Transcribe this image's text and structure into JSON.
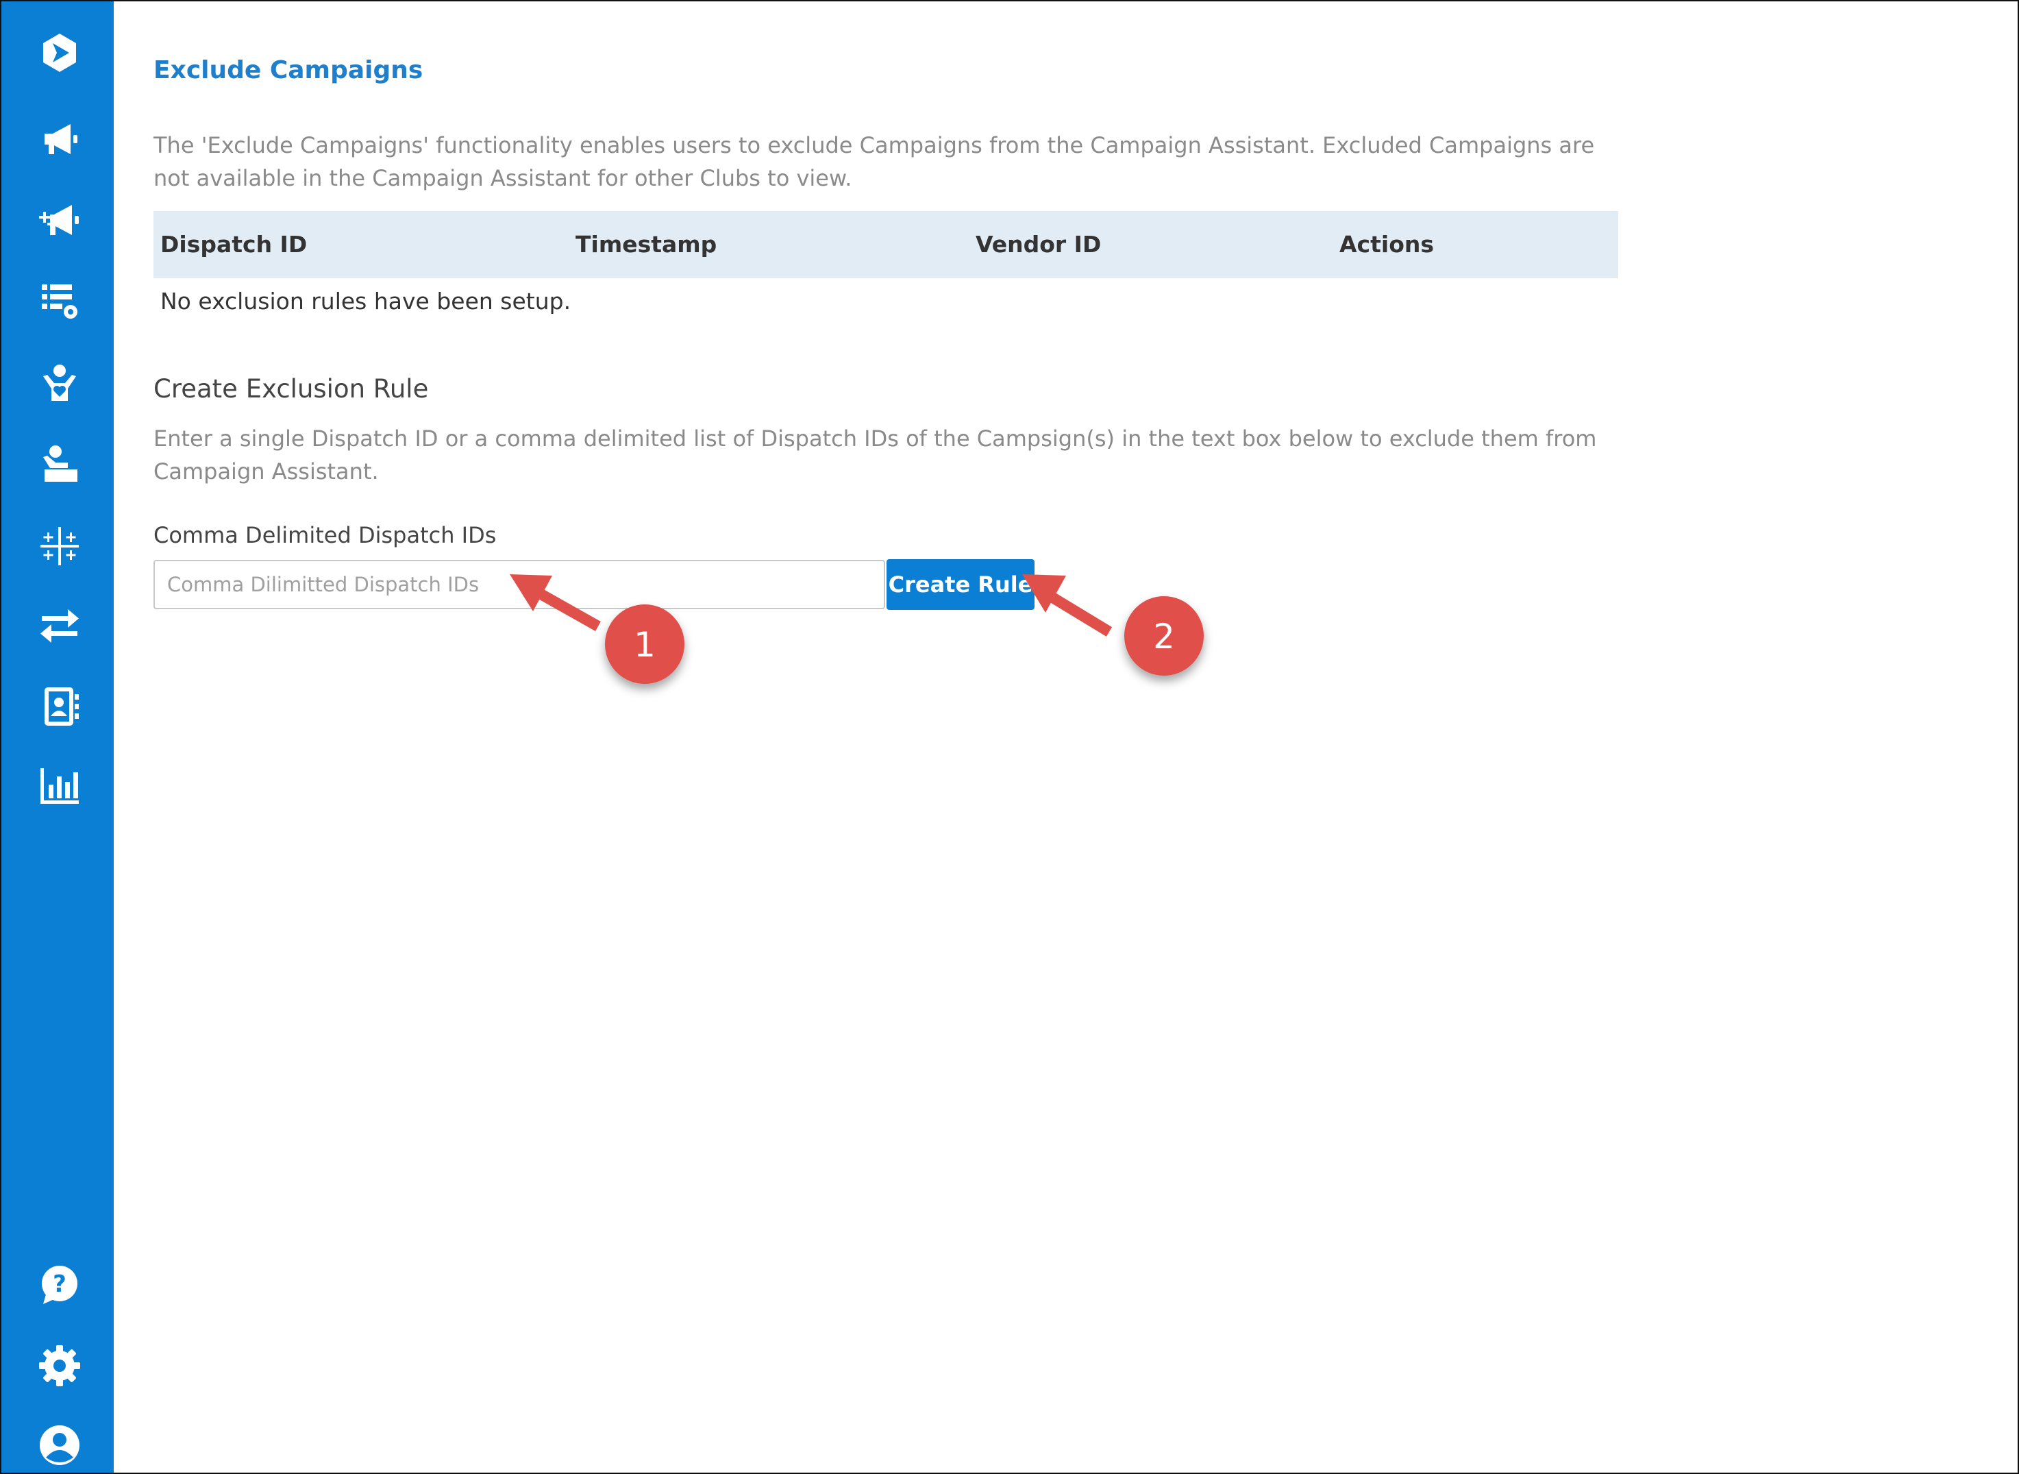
{
  "sidebar": {
    "items": [
      {
        "icon": "app-logo-icon"
      },
      {
        "icon": "megaphone-icon"
      },
      {
        "icon": "megaphone-plus-icon"
      },
      {
        "icon": "list-settings-icon"
      },
      {
        "icon": "user-heart-icon"
      },
      {
        "icon": "user-desk-icon"
      },
      {
        "icon": "sparkle-grid-icon"
      },
      {
        "icon": "transfer-arrows-icon"
      },
      {
        "icon": "contact-book-icon"
      },
      {
        "icon": "bar-chart-icon"
      }
    ],
    "bottom_items": [
      {
        "icon": "help-chat-icon"
      },
      {
        "icon": "gear-icon"
      },
      {
        "icon": "user-profile-icon"
      }
    ],
    "color": "#0A7FD4"
  },
  "page": {
    "title": "Exclude Campaigns",
    "description": "The 'Exclude Campaigns' functionality enables users to exclude Campaigns from the Campaign Assistant. Excluded Campaigns are not available in the Campaign Assistant for other Clubs to view."
  },
  "table": {
    "columns": [
      "Dispatch ID",
      "Timestamp",
      "Vendor ID",
      "Actions"
    ],
    "empty_message": "No exclusion rules have been setup."
  },
  "create_rule": {
    "title": "Create Exclusion Rule",
    "instructions": "Enter a single Dispatch ID or a comma delimited list of Dispatch IDs of the Campsign(s) in the text box below to exclude them from Campaign Assistant.",
    "field_label": "Comma Delimited Dispatch IDs",
    "input_value": "",
    "input_placeholder": "Comma Dilimitted Dispatch IDs",
    "button_label": "Create Rule"
  },
  "annotations": {
    "badge_1": "1",
    "badge_2": "2",
    "color": "#E0504A"
  }
}
